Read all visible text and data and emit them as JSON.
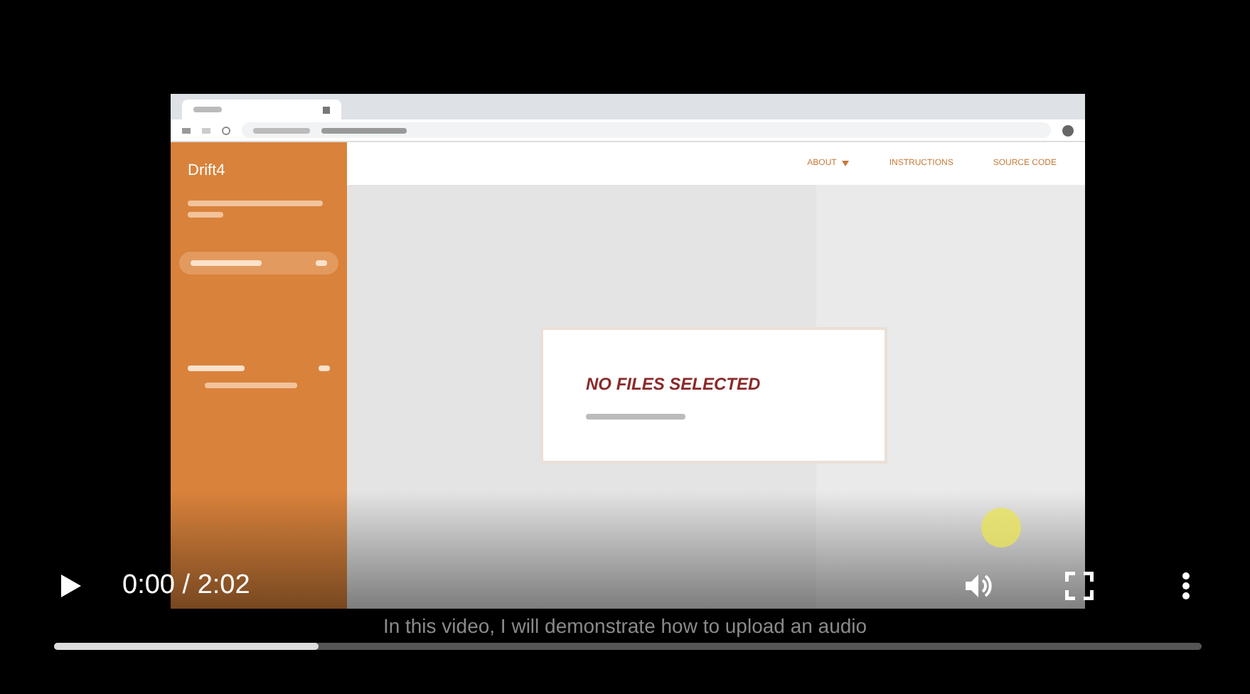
{
  "video_frame": {
    "app": {
      "title": "Drift4",
      "nav": [
        {
          "label": "ABOUT",
          "kind": "dropdown"
        },
        {
          "label": "INSTRUCTIONS",
          "kind": "link"
        },
        {
          "label": "SOURCE CODE",
          "kind": "link"
        }
      ],
      "empty_state": {
        "heading": "NO FILES SELECTED"
      }
    }
  },
  "player": {
    "time": "0:00 / 2:02",
    "caption": "In this video, I will demonstrate how to upload an audio",
    "progress": {
      "level": 0.23
    }
  }
}
